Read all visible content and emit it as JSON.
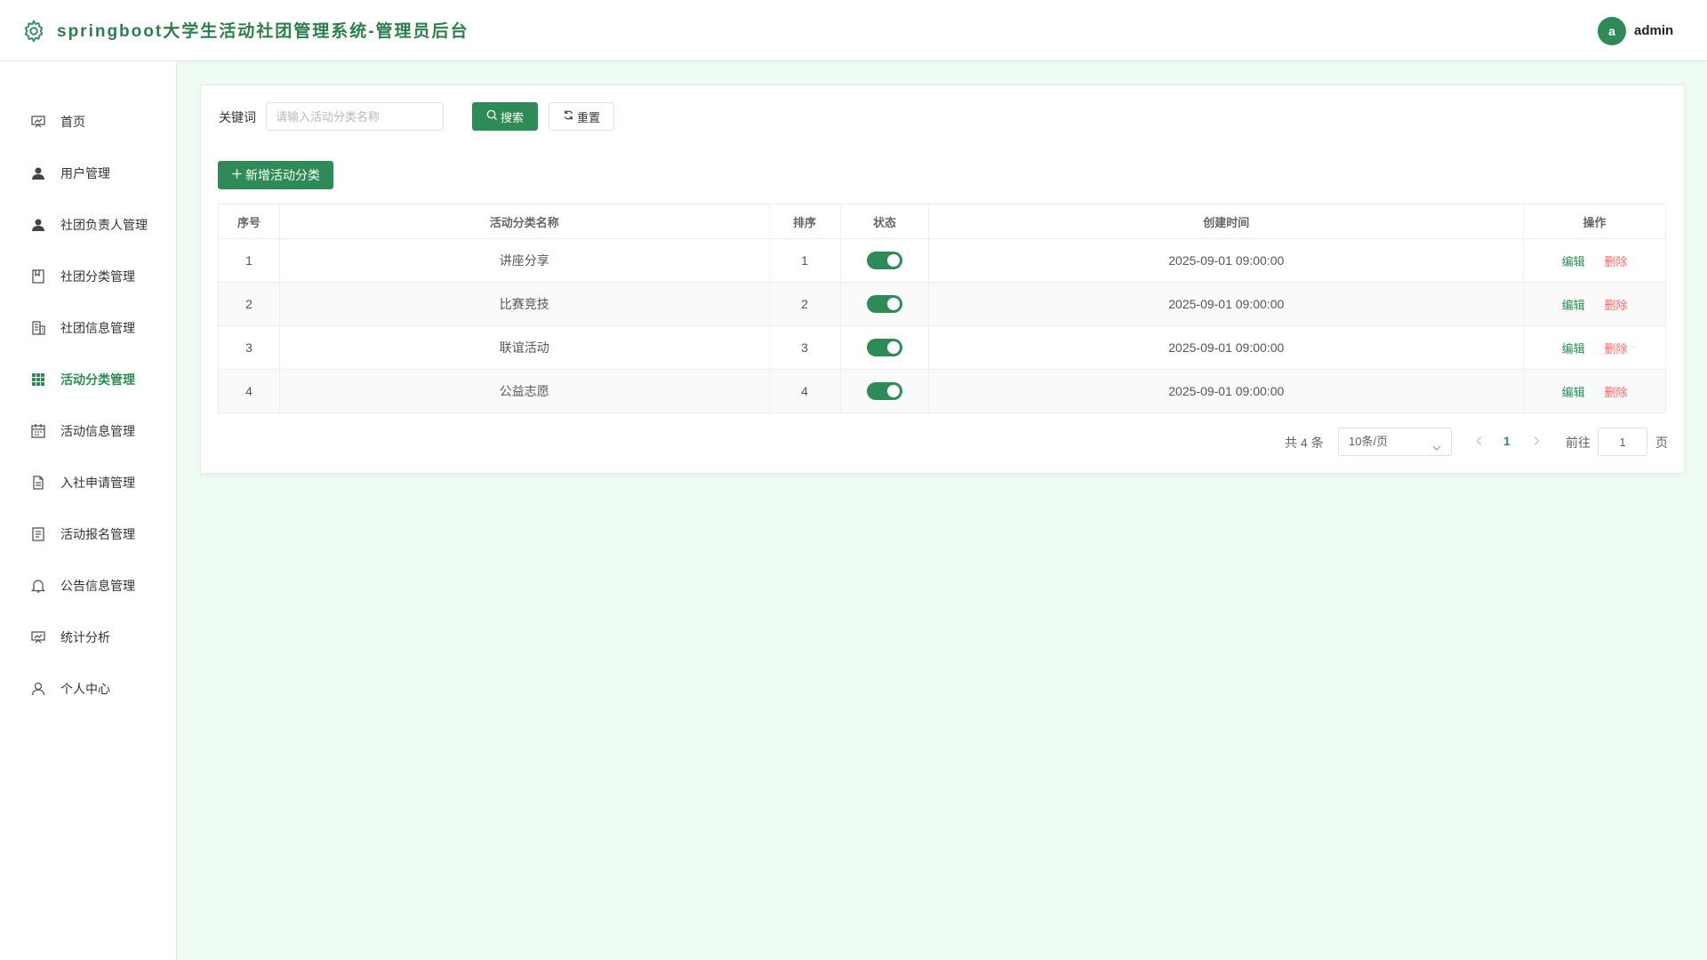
{
  "header": {
    "title": "springboot大学生活动社团管理系统-管理员后台",
    "avatar_letter": "a",
    "username": "admin"
  },
  "sidebar": {
    "items": [
      {
        "label": "首页",
        "icon": "dashboard-icon"
      },
      {
        "label": "用户管理",
        "icon": "user-icon"
      },
      {
        "label": "社团负责人管理",
        "icon": "user-icon"
      },
      {
        "label": "社团分类管理",
        "icon": "notebook-icon"
      },
      {
        "label": "社团信息管理",
        "icon": "building-icon"
      },
      {
        "label": "活动分类管理",
        "icon": "grid-icon",
        "active": true
      },
      {
        "label": "活动信息管理",
        "icon": "calendar-icon"
      },
      {
        "label": "入社申请管理",
        "icon": "document-icon"
      },
      {
        "label": "活动报名管理",
        "icon": "list-icon"
      },
      {
        "label": "公告信息管理",
        "icon": "bell-icon"
      },
      {
        "label": "统计分析",
        "icon": "chart-icon"
      },
      {
        "label": "个人中心",
        "icon": "person-icon"
      }
    ]
  },
  "search": {
    "label": "关键词",
    "placeholder": "请输入活动分类名称",
    "value": "",
    "search_button": "搜索",
    "reset_button": "重置"
  },
  "toolbar": {
    "add_button": "新增活动分类"
  },
  "table": {
    "columns": [
      "序号",
      "活动分类名称",
      "排序",
      "状态",
      "创建时间",
      "操作"
    ],
    "rows": [
      {
        "index": "1",
        "name": "讲座分享",
        "sort": "1",
        "status_on": true,
        "created": "2025-09-01 09:00:00"
      },
      {
        "index": "2",
        "name": "比赛竞技",
        "sort": "2",
        "status_on": true,
        "created": "2025-09-01 09:00:00"
      },
      {
        "index": "3",
        "name": "联谊活动",
        "sort": "3",
        "status_on": true,
        "created": "2025-09-01 09:00:00"
      },
      {
        "index": "4",
        "name": "公益志愿",
        "sort": "4",
        "status_on": true,
        "created": "2025-09-01 09:00:00"
      }
    ],
    "actions": {
      "edit": "编辑",
      "delete": "删除"
    }
  },
  "pagination": {
    "total_text": "共 4 条",
    "page_size": "10条/页",
    "current_page": "1",
    "goto_label": "前往",
    "goto_value": "1",
    "goto_unit": "页"
  },
  "colors": {
    "accent": "#2e8b57",
    "danger": "#f56c6c",
    "background": "#eefcf3"
  }
}
